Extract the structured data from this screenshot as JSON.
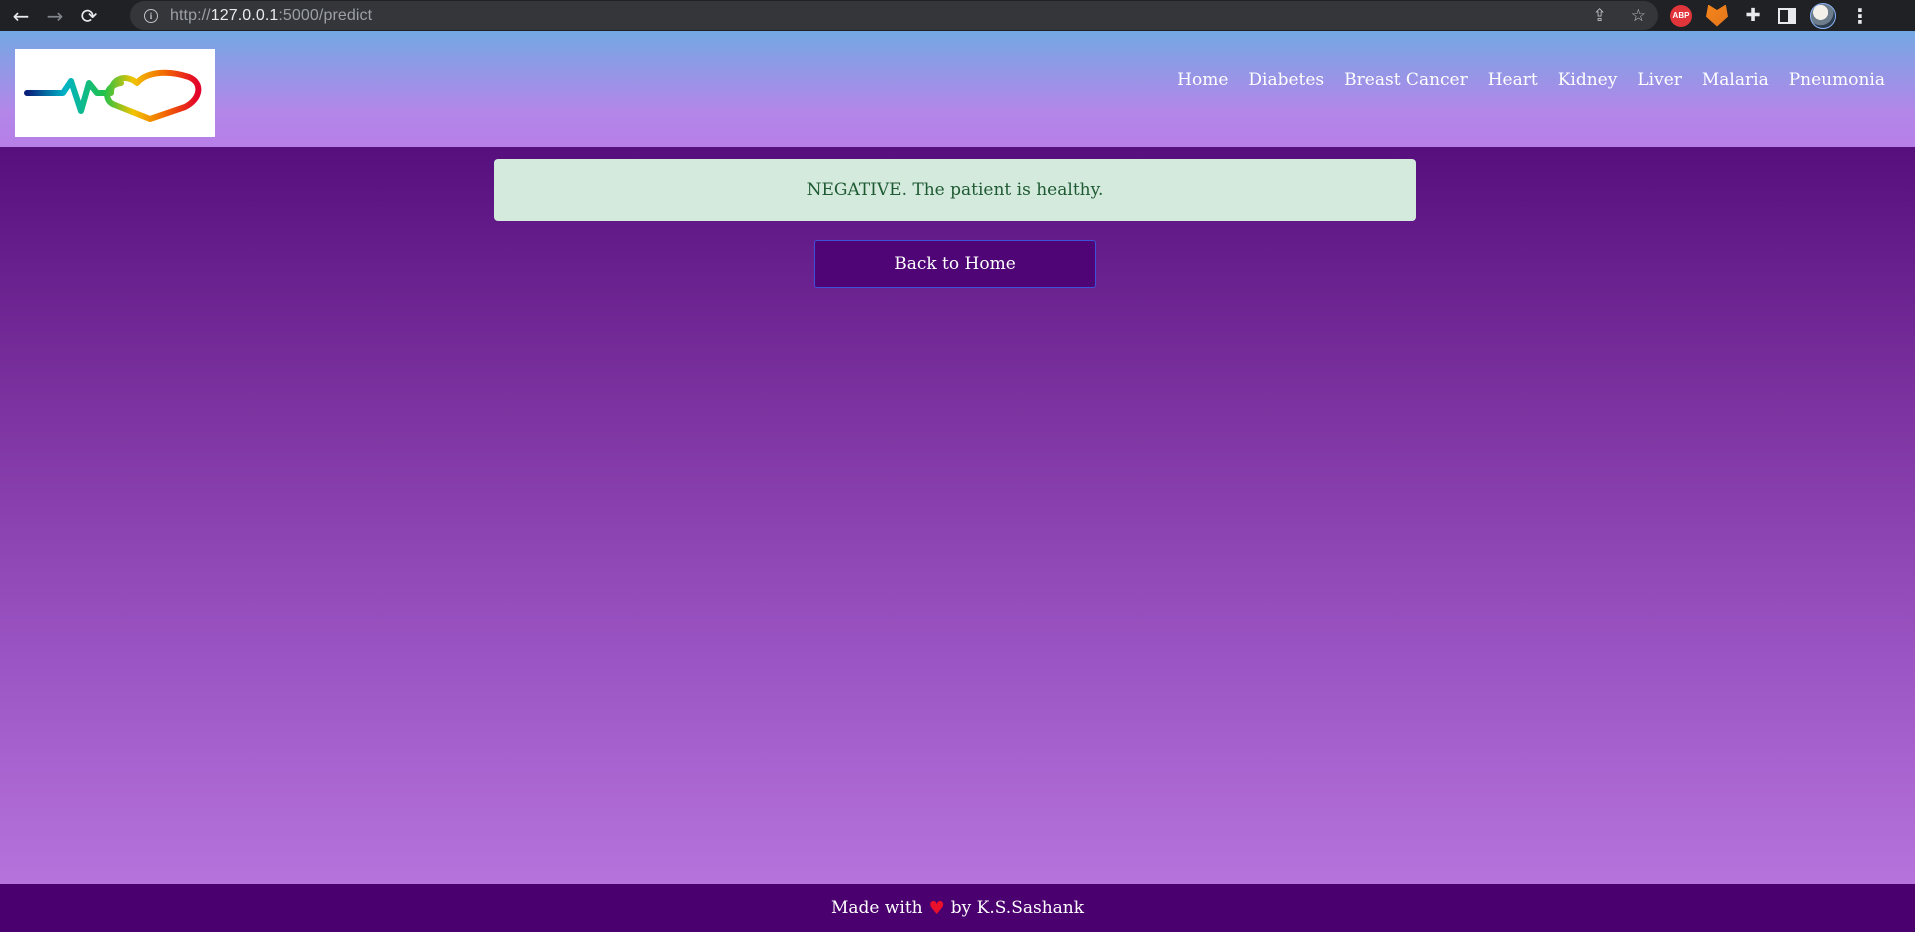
{
  "browser": {
    "url_scheme": "http://",
    "url_host": "127.0.0.1",
    "url_rest": ":5000/predict",
    "extensions": [
      "abp-icon",
      "metamask-fox-icon",
      "puzzle-icon",
      "side-panel-icon",
      "profile-avatar",
      "menu-icon"
    ],
    "abp_label": "ABP"
  },
  "header": {
    "nav": [
      "Home",
      "Diabetes",
      "Breast Cancer",
      "Heart",
      "Kidney",
      "Liver",
      "Malaria",
      "Pneumonia"
    ]
  },
  "main": {
    "result_message": "NEGATIVE. The patient is healthy.",
    "back_button_label": "Back to Home"
  },
  "footer": {
    "prefix": "Made with",
    "heart": "♥",
    "suffix": "by K.S.Sashank"
  },
  "colors": {
    "header_top": "#74a8e4",
    "header_bottom": "#b67fe8",
    "content_top": "#560f7d",
    "content_bottom": "#b673dc",
    "alert_bg": "#d4eadc",
    "alert_text": "#1e5a33",
    "button_bg": "#4f0575",
    "footer_bg": "#4a006e",
    "heart": "#e8102b"
  }
}
